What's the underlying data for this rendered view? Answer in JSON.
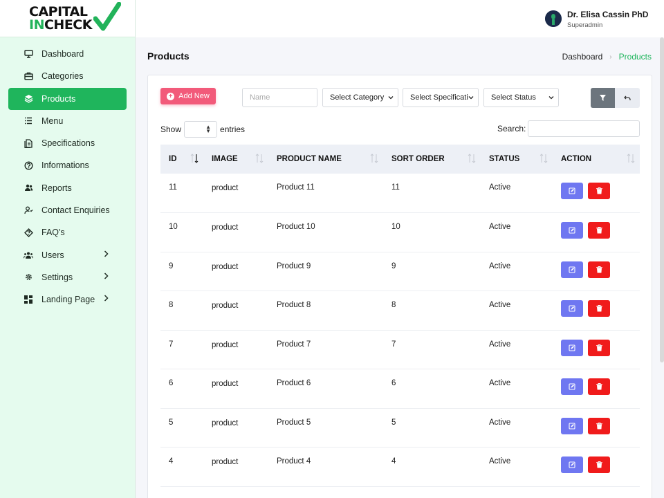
{
  "logo": {
    "line1": "CAPITAL",
    "line2_in": "IN",
    "line2_rest": "CHECK"
  },
  "sidebar": {
    "items": [
      {
        "label": "Dashboard",
        "icon": "monitor-icon"
      },
      {
        "label": "Categories",
        "icon": "briefcase-icon"
      },
      {
        "label": "Products",
        "icon": "layers-icon",
        "active": true
      },
      {
        "label": "Menu",
        "icon": "list-icon"
      },
      {
        "label": "Specifications",
        "icon": "document-icon"
      },
      {
        "label": "Informations",
        "icon": "question-icon"
      },
      {
        "label": "Reports",
        "icon": "people-icon"
      },
      {
        "label": "Contact Enquiries",
        "icon": "contact-icon"
      },
      {
        "label": "FAQ's",
        "icon": "faq-icon"
      },
      {
        "label": "Users",
        "icon": "users-icon",
        "has_children": true
      },
      {
        "label": "Settings",
        "icon": "settings-icon",
        "has_children": true
      },
      {
        "label": "Landing Page",
        "icon": "grid-icon",
        "has_children": true
      }
    ]
  },
  "user": {
    "name": "Dr. Elisa Cassin PhD",
    "role": "Superadmin"
  },
  "page": {
    "title": "Products"
  },
  "breadcrumb": {
    "home": "Dashboard",
    "current": "Products"
  },
  "toolbar": {
    "add_label": "Add New",
    "name_placeholder": "Name",
    "category": "Select Category",
    "specification": "Select Specificati",
    "status": "Select Status"
  },
  "table_controls": {
    "show": "Show",
    "entries": "entries",
    "search": "Search:"
  },
  "table": {
    "columns": [
      "ID",
      "IMAGE",
      "PRODUCT NAME",
      "SORT ORDER",
      "STATUS",
      "ACTION"
    ],
    "rows": [
      {
        "id": "11",
        "image": "product",
        "name": "Product 11",
        "sort": "11",
        "status": "Active"
      },
      {
        "id": "10",
        "image": "product",
        "name": "Product 10",
        "sort": "10",
        "status": "Active"
      },
      {
        "id": "9",
        "image": "product",
        "name": "Product 9",
        "sort": "9",
        "status": "Active"
      },
      {
        "id": "8",
        "image": "product",
        "name": "Product 8",
        "sort": "8",
        "status": "Active"
      },
      {
        "id": "7",
        "image": "product",
        "name": "Product 7",
        "sort": "7",
        "status": "Active"
      },
      {
        "id": "6",
        "image": "product",
        "name": "Product 6",
        "sort": "6",
        "status": "Active"
      },
      {
        "id": "5",
        "image": "product",
        "name": "Product 5",
        "sort": "5",
        "status": "Active"
      },
      {
        "id": "4",
        "image": "product",
        "name": "Product 4",
        "sort": "4",
        "status": "Active"
      }
    ]
  },
  "colors": {
    "brand_green": "#1fb55c",
    "add_button": "#f25a7a",
    "edit_button": "#6f77f1",
    "delete_button": "#f01b1b"
  }
}
